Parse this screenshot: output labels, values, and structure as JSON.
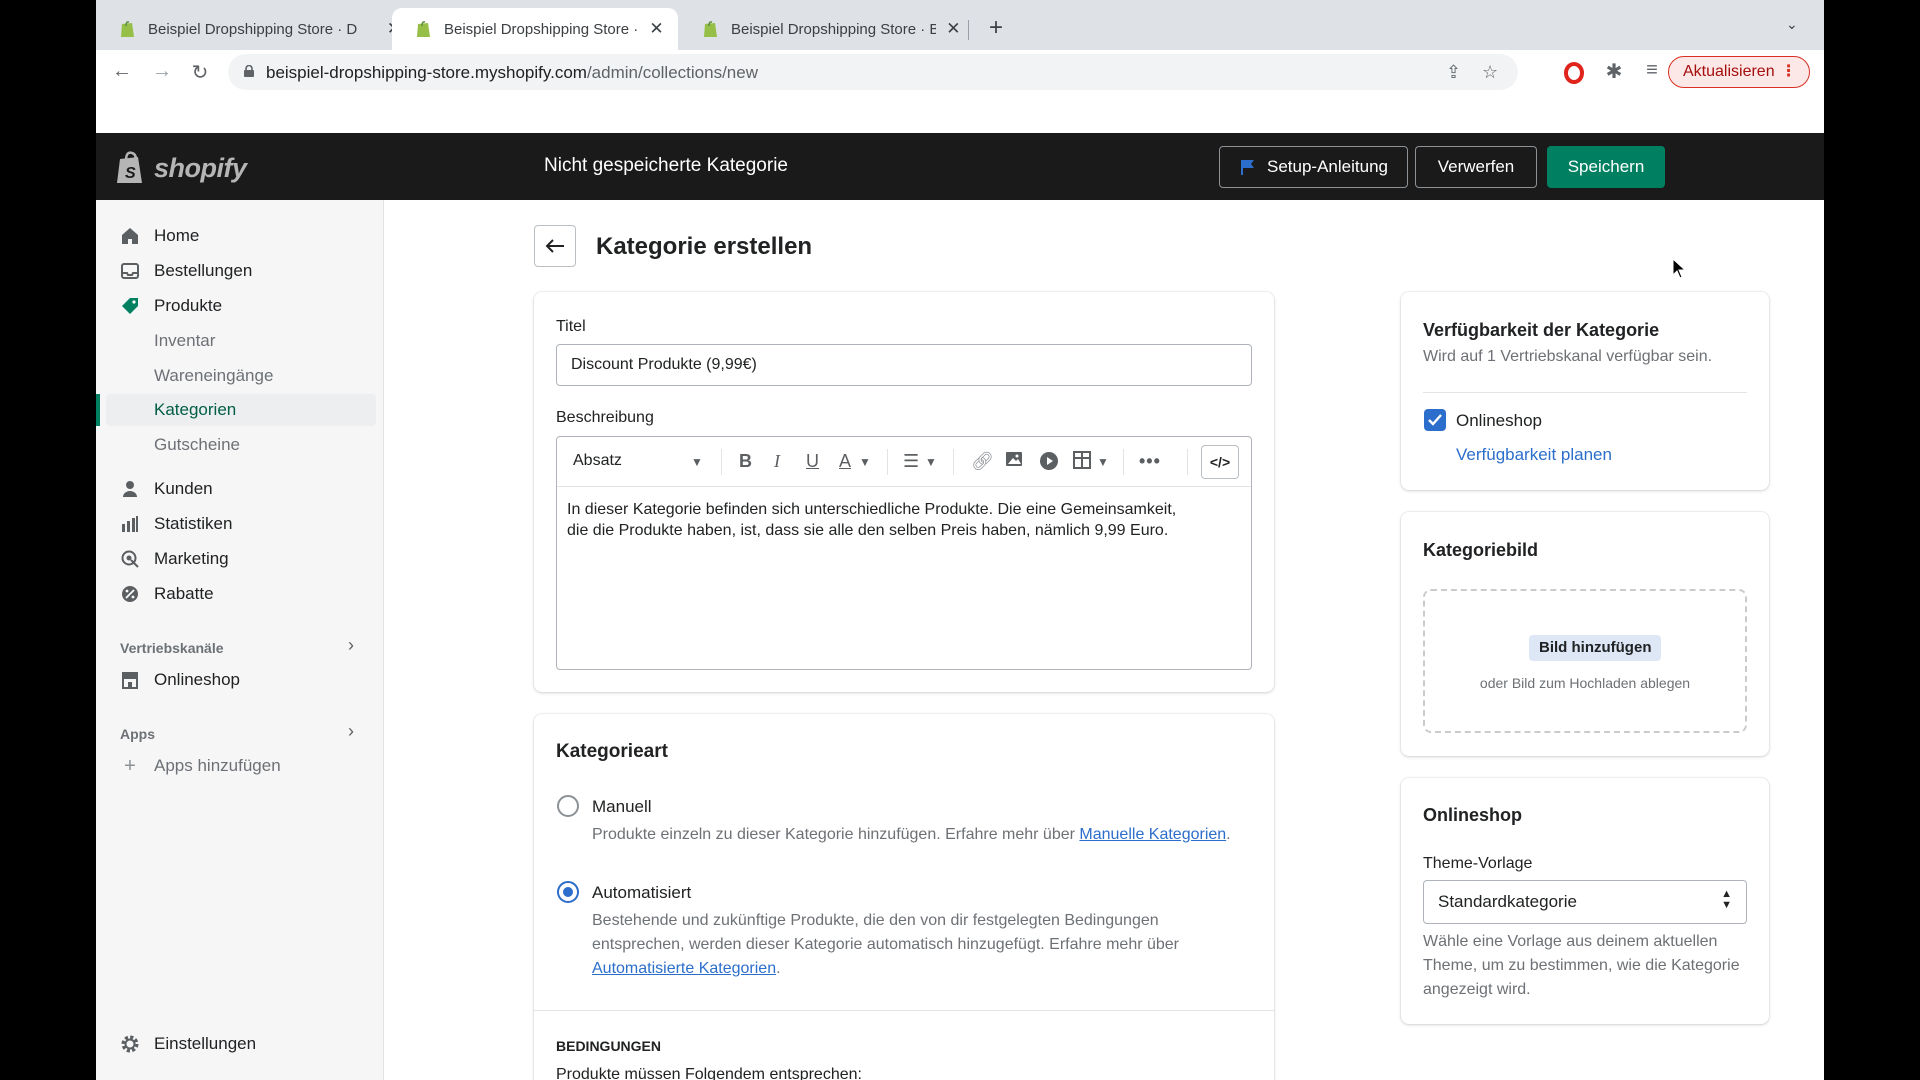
{
  "browser": {
    "tabs": [
      {
        "title": "Beispiel Dropshipping Store · D"
      },
      {
        "title": "Beispiel Dropshipping Store · K"
      },
      {
        "title": "Beispiel Dropshipping Store · B"
      }
    ],
    "url_host": "beispiel-dropshipping-store.myshopify.com",
    "url_path": "/admin/collections/new",
    "update_label": "Aktualisieren"
  },
  "topbar": {
    "logo_text": "shopify",
    "title": "Nicht gespeicherte Kategorie",
    "setup_label": "Setup-Anleitung",
    "discard_label": "Verwerfen",
    "save_label": "Speichern"
  },
  "sidebar": {
    "home": "Home",
    "orders": "Bestellungen",
    "products": "Produkte",
    "inventory": "Inventar",
    "transfers": "Wareneingänge",
    "collections": "Kategorien",
    "gift_cards": "Gutscheine",
    "customers": "Kunden",
    "analytics": "Statistiken",
    "marketing": "Marketing",
    "discounts": "Rabatte",
    "sales_channels_label": "Vertriebskanäle",
    "online_store": "Onlineshop",
    "apps_label": "Apps",
    "add_apps": "Apps hinzufügen",
    "settings": "Einstellungen"
  },
  "page": {
    "title": "Kategorie erstellen"
  },
  "details_card": {
    "title_label": "Titel",
    "title_value": "Discount Produkte (9,99€)",
    "description_label": "Beschreibung",
    "format_select": "Absatz",
    "description_line1": "In dieser Kategorie befinden sich unterschiedliche Produkte. Die eine Gemeinsamkeit,",
    "description_line2": "die die Produkte haben, ist, dass sie alle den selben Preis haben, nämlich 9,99 Euro."
  },
  "type_card": {
    "heading": "Kategorieart",
    "manual_label": "Manuell",
    "manual_desc": "Produkte einzeln zu dieser Kategorie hinzufügen. Erfahre mehr über",
    "manual_link": "Manuelle Kategorien",
    "auto_label": "Automatisiert",
    "auto_desc": "Bestehende und zukünftige Produkte, die den von dir festgelegten Bedingungen entsprechen, werden dieser Kategorie automatisch hinzugefügt. Erfahre mehr über",
    "auto_link": "Automatisierte Kategorien",
    "conditions_heading": "BEDINGUNGEN",
    "conditions_sub": "Produkte müssen Folgendem entsprechen:"
  },
  "availability_card": {
    "heading": "Verfügbarkeit der Kategorie",
    "sub": "Wird auf 1 Vertriebskanal verfügbar sein.",
    "channel": "Onlineshop",
    "schedule_link": "Verfügbarkeit planen"
  },
  "image_card": {
    "heading": "Kategoriebild",
    "add_label": "Bild hinzufügen",
    "hint": "oder Bild zum Hochladen ablegen"
  },
  "online_store_card": {
    "heading": "Onlineshop",
    "template_label": "Theme-Vorlage",
    "template_value": "Standardkategorie",
    "help": "Wähle eine Vorlage aus deinem aktuellen Theme, um zu bestimmen, wie die Kategorie angezeigt wird."
  },
  "colors": {
    "primary_green": "#008060",
    "topbar_bg": "#1a1a1a",
    "link_blue": "#2c6ecb"
  }
}
